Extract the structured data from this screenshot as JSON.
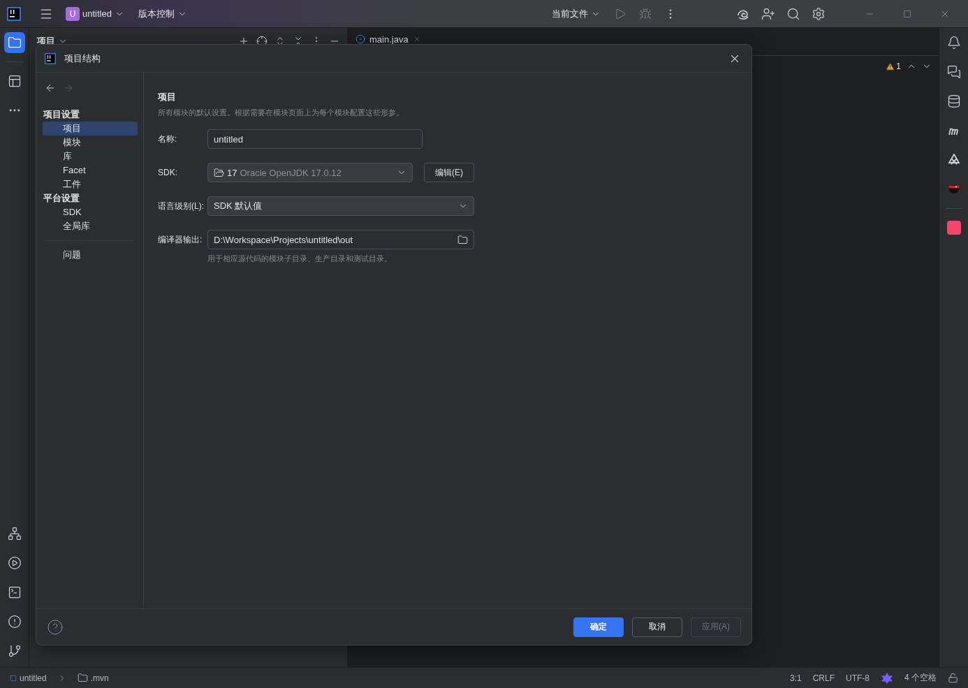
{
  "title_bar": {
    "project_badge": "U",
    "project": "untitled",
    "vcs": "版本控制",
    "run_config": "当前文件"
  },
  "project_panel": {
    "title": "项目"
  },
  "editor": {
    "tabs": [
      {
        "label": "main.java"
      }
    ],
    "warning_count": "1"
  },
  "dialog": {
    "title": "项目结构",
    "nav": [
      {
        "kind": "header",
        "label": "项目设置"
      },
      {
        "kind": "item",
        "label": "项目",
        "selected": true
      },
      {
        "kind": "item",
        "label": "模块",
        "selected": false
      },
      {
        "kind": "item",
        "label": "库",
        "selected": false
      },
      {
        "kind": "item",
        "label": "Facet",
        "selected": false
      },
      {
        "kind": "item",
        "label": "工件",
        "selected": false
      },
      {
        "kind": "header",
        "label": "平台设置"
      },
      {
        "kind": "item",
        "label": "SDK",
        "selected": false
      },
      {
        "kind": "item",
        "label": "全局库",
        "selected": false
      },
      {
        "kind": "separator"
      },
      {
        "kind": "item",
        "label": "问题",
        "selected": false
      }
    ],
    "page": {
      "title": "项目",
      "description": "所有模块的默认设置。根据需要在模块页面上为每个模块配置这些形参。",
      "fields": [
        {
          "kind": "text",
          "label": "名称:",
          "value": "untitled"
        },
        {
          "kind": "sdk",
          "label": "SDK:",
          "version": "17",
          "value": "Oracle OpenJDK 17.0.12",
          "button": "编辑(E)"
        },
        {
          "kind": "select",
          "label": "语言级别(L):",
          "value": "SDK 默认值"
        },
        {
          "kind": "path",
          "label": "编译器输出:",
          "value": "D:\\Workspace\\Projects\\untitled\\out",
          "hint": "用于相应源代码的模块子目录、生产目录和测试目录。"
        }
      ]
    },
    "buttons": [
      {
        "label": "确定",
        "kind": "primary",
        "disabled": false
      },
      {
        "label": "取消",
        "kind": "secondary",
        "disabled": false
      },
      {
        "label": "应用(A)",
        "kind": "secondary",
        "disabled": true
      }
    ]
  },
  "status_bar": {
    "breadcrumbs": [
      "untitled",
      ".mvn"
    ],
    "position": "3:1",
    "line_ending": "CRLF",
    "encoding": "UTF-8",
    "indent": "4 个空格"
  }
}
